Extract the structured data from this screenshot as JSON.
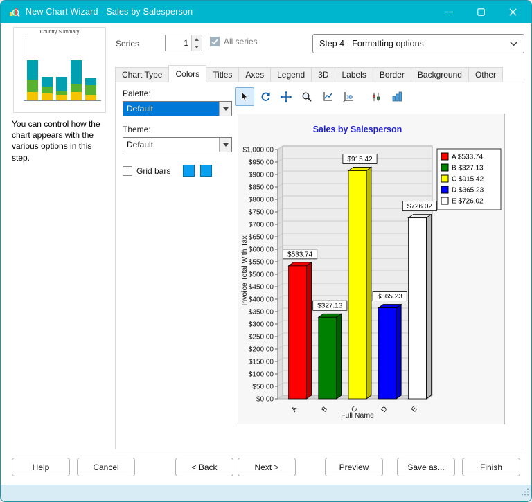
{
  "window": {
    "title": "New Chart Wizard - Sales by Salesperson"
  },
  "sidebar": {
    "thumbnail_title": "Country Summary",
    "description": "You can control how the chart appears with the various options in this step.",
    "thumbnail": {
      "colors": [
        "#f4c400",
        "#57b32f",
        "#00a0b0"
      ],
      "bars": [
        [
          12,
          18,
          28
        ],
        [
          10,
          10,
          14
        ],
        [
          8,
          6,
          20
        ],
        [
          12,
          12,
          34
        ],
        [
          8,
          14,
          10
        ]
      ]
    }
  },
  "header": {
    "series_label": "Series",
    "series_value": "1",
    "all_series_label": "All series",
    "step_value": "Step 4 - Formatting options"
  },
  "tabs": {
    "items": [
      "Chart Type",
      "Colors",
      "Titles",
      "Axes",
      "Legend",
      "3D",
      "Labels",
      "Border",
      "Background",
      "Other"
    ],
    "active": "Colors"
  },
  "options": {
    "palette_label": "Palette:",
    "palette_value": "Default",
    "theme_label": "Theme:",
    "theme_value": "Default",
    "grid_bars_label": "Grid bars",
    "swatch_colors": [
      "#0a9ff0",
      "#0a9ff0"
    ]
  },
  "toolbar": {
    "tools": [
      "pointer",
      "rotate",
      "pan",
      "zoom",
      "chart-2d",
      "chart-3d",
      "series-points",
      "histogram"
    ],
    "selected": "pointer"
  },
  "chart_data": {
    "type": "bar",
    "title": "Sales by Salesperson",
    "title_color": "#2020cc",
    "xlabel": "Full Name",
    "ylabel": "Invoice Total With Tax",
    "categories": [
      "A",
      "B",
      "C",
      "D",
      "E"
    ],
    "values": [
      533.74,
      327.13,
      915.42,
      365.23,
      726.02
    ],
    "bar_colors": [
      "#ff0000",
      "#008000",
      "#ffff00",
      "#0000ff",
      "#ffffff"
    ],
    "data_labels": [
      "$533.74",
      "$327.13",
      "$915.42",
      "$365.23",
      "$726.02"
    ],
    "legend": [
      {
        "label": "A $533.74",
        "color": "#ff0000"
      },
      {
        "label": "B $327.13",
        "color": "#008000"
      },
      {
        "label": "C $915.42",
        "color": "#ffff00"
      },
      {
        "label": "D $365.23",
        "color": "#0000ff"
      },
      {
        "label": "E $726.02",
        "color": "#ffffff"
      }
    ],
    "ylim": [
      0,
      1000
    ],
    "ytick_step": 50,
    "grid": true,
    "legend_position": "top-right"
  },
  "footer": {
    "buttons": [
      "Help",
      "Cancel",
      "< Back",
      "Next >",
      "Preview",
      "Save as...",
      "Finish"
    ]
  }
}
